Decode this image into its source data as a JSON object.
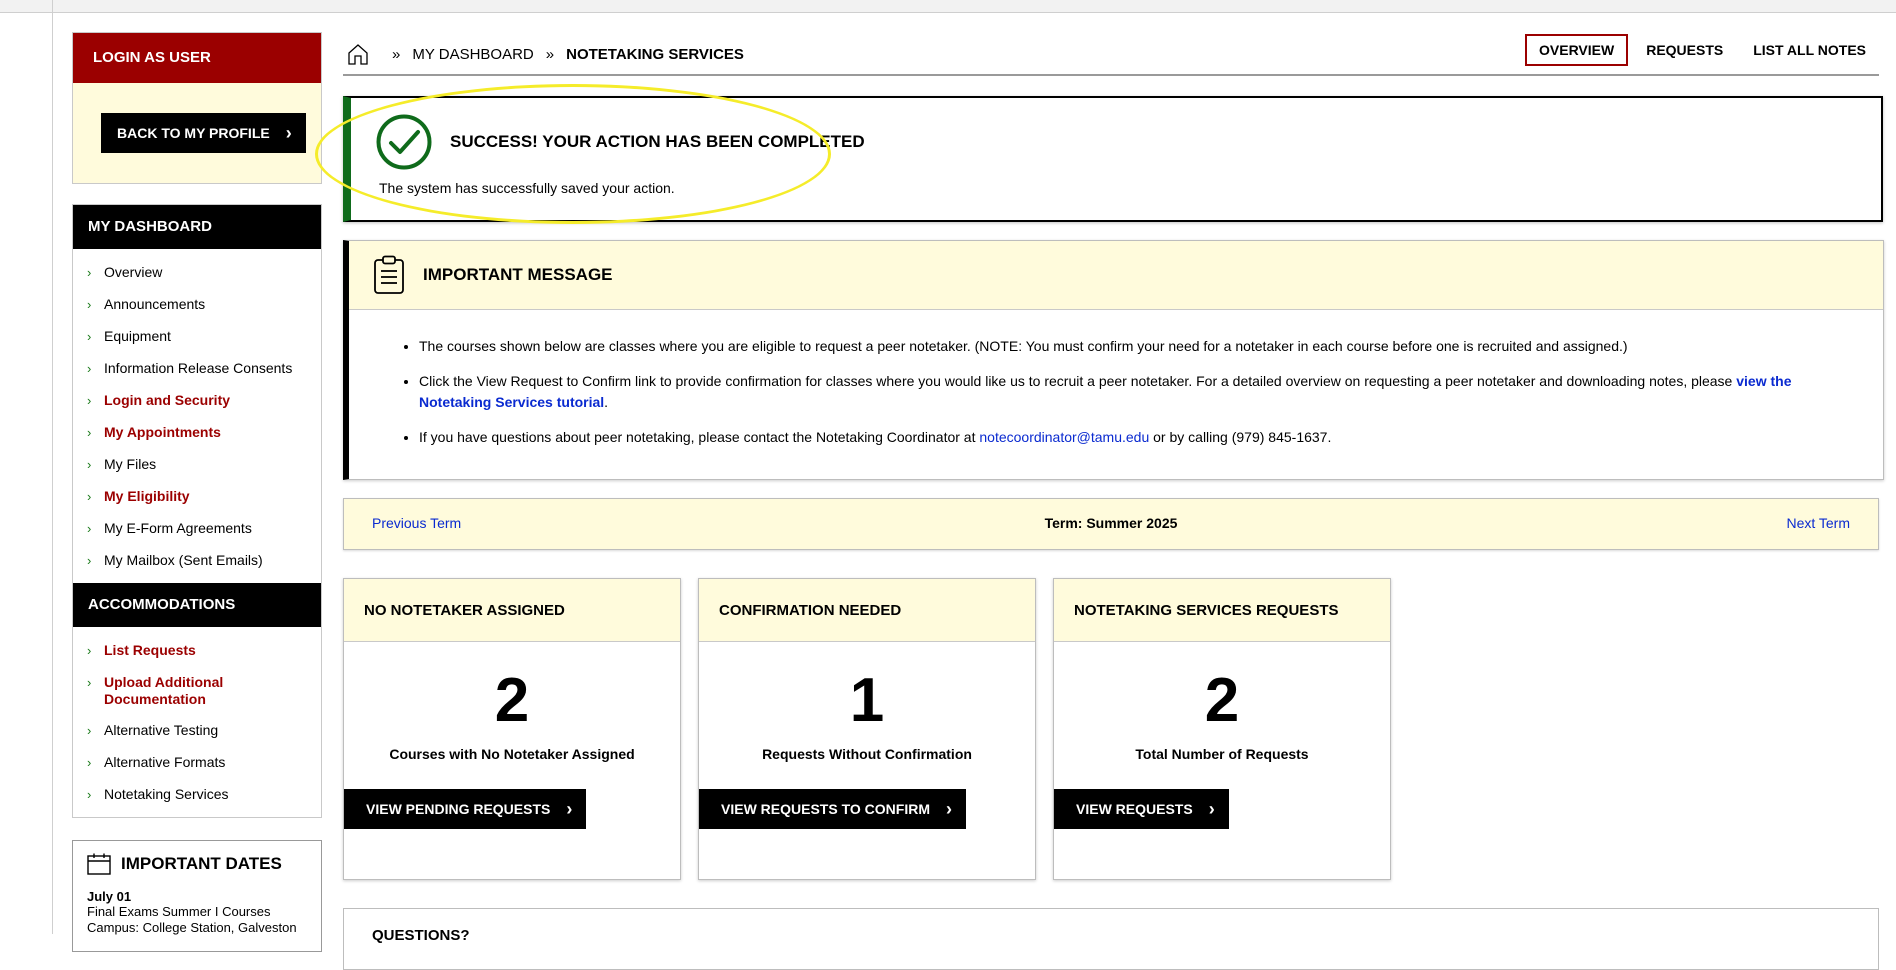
{
  "sidebar": {
    "login_title": "LOGIN AS USER",
    "back_button": "BACK TO MY PROFILE",
    "dashboard_title": "MY DASHBOARD",
    "dashboard_items": [
      {
        "label": "Overview"
      },
      {
        "label": "Announcements"
      },
      {
        "label": "Equipment"
      },
      {
        "label": "Information Release Consents"
      },
      {
        "label": "Login and Security"
      },
      {
        "label": "My Appointments"
      },
      {
        "label": "My Files"
      },
      {
        "label": "My Eligibility"
      },
      {
        "label": "My E-Form Agreements"
      },
      {
        "label": "My Mailbox (Sent Emails)"
      }
    ],
    "accommodations_title": "ACCOMMODATIONS",
    "accommodation_items": [
      {
        "label": "List Requests"
      },
      {
        "label": "Upload Additional Documentation"
      },
      {
        "label": "Alternative Testing"
      },
      {
        "label": "Alternative Formats"
      },
      {
        "label": "Notetaking Services"
      }
    ],
    "dates_title": "IMPORTANT DATES",
    "dates_first_day": "July 01",
    "dates_first_text": "Final Exams Summer I Courses",
    "dates_first_text2": "Campus: College Station, Galveston"
  },
  "header": {
    "crumb_dashboard": "MY DASHBOARD",
    "crumb_current": "NOTETAKING SERVICES",
    "tabs": [
      {
        "label": "OVERVIEW"
      },
      {
        "label": "REQUESTS"
      },
      {
        "label": "LIST ALL NOTES"
      }
    ]
  },
  "success": {
    "title": "SUCCESS! YOUR ACTION HAS BEEN COMPLETED",
    "message": "The system has successfully saved your action."
  },
  "important": {
    "title": "IMPORTANT MESSAGE",
    "item1": "The courses shown below are classes where you are eligible to request a peer notetaker. (NOTE: You must confirm your need for a notetaker in each course before one is recruited and assigned.)",
    "item2_text": "Click the View Request to Confirm link to provide confirmation for classes where you would like us to recruit a peer notetaker. For a detailed overview on requesting a peer notetaker and downloading notes, please ",
    "item2_link": "view the Notetaking Services tutorial",
    "item2_end": ".",
    "item3_text": "If you have questions about peer notetaking, please contact the Notetaking Coordinator at ",
    "item3_email": "notecoordinator@tamu.edu",
    "item3_end": " or by calling (979) 845-1637."
  },
  "term": {
    "prev": "Previous Term",
    "current": "Term: Summer 2025",
    "next": "Next Term"
  },
  "cards": [
    {
      "title": "NO NOTETAKER ASSIGNED",
      "count": "2",
      "desc": "Courses with No Notetaker Assigned",
      "button": "VIEW PENDING REQUESTS"
    },
    {
      "title": "CONFIRMATION NEEDED",
      "count": "1",
      "desc": "Requests Without Confirmation",
      "button": "VIEW REQUESTS TO CONFIRM"
    },
    {
      "title": "NOTETAKING SERVICES REQUESTS",
      "count": "2",
      "desc": "Total Number of Requests",
      "button": "VIEW REQUESTS"
    }
  ],
  "questions": {
    "title": "QUESTIONS?"
  },
  "colors": {
    "brand_maroon": "#9b0000",
    "success_green": "#0f6b1b",
    "panel_yellow": "#fffbdc",
    "link_blue": "#0a2ad0",
    "annotation_yellow": "#f5ec2a"
  }
}
